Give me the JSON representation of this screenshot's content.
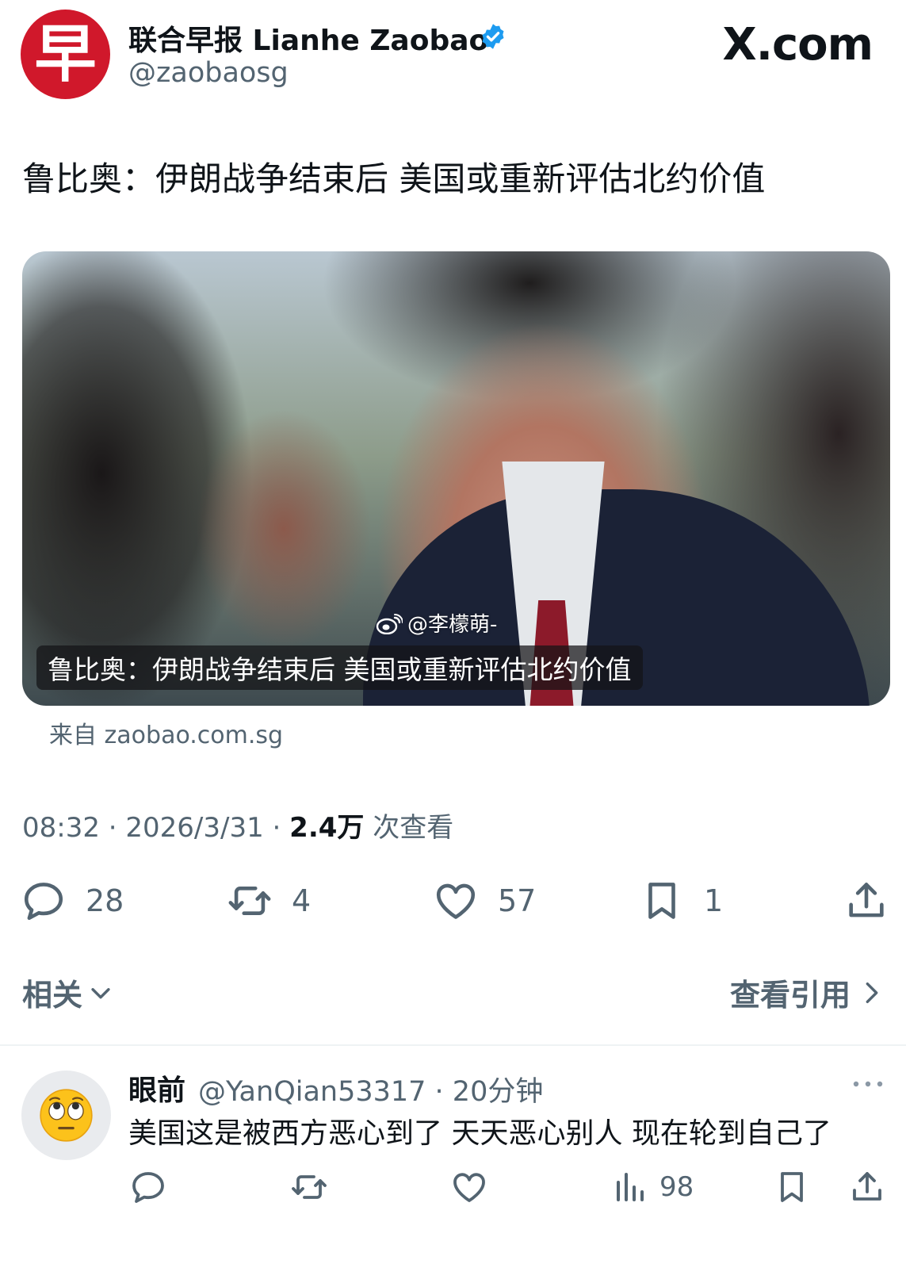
{
  "tweet": {
    "author_name": "联合早报 Lianhe Zaobao",
    "author_handle": "@zaobaosg",
    "avatar_glyph": "早",
    "brand": "X.com",
    "text": "鲁比奥：伊朗战争结束后 美国或重新评估北约价值",
    "media": {
      "watermark": "@李檬萌-",
      "caption": "鲁比奥：伊朗战争结束后 美国或重新评估北约价值"
    },
    "source": "来自 zaobao.com.sg",
    "time": "08:32 · 2026/3/31 · ",
    "views_count": "2.4万",
    "views_label": " 次查看",
    "actions": {
      "replies": "28",
      "reposts": "4",
      "likes": "57",
      "bookmarks": "1"
    },
    "related_label": "相关",
    "quotes_label": "查看引用"
  },
  "reply": {
    "name": "眼前",
    "meta": "@YanQian53317 · 20分钟",
    "text": "美国这是被西方恶心到了 天天恶心别人 现在轮到自己了",
    "views": "98"
  },
  "colors": {
    "brand_red": "#d0182b",
    "verified_blue": "#1d9bf0",
    "secondary_text": "#536471"
  }
}
